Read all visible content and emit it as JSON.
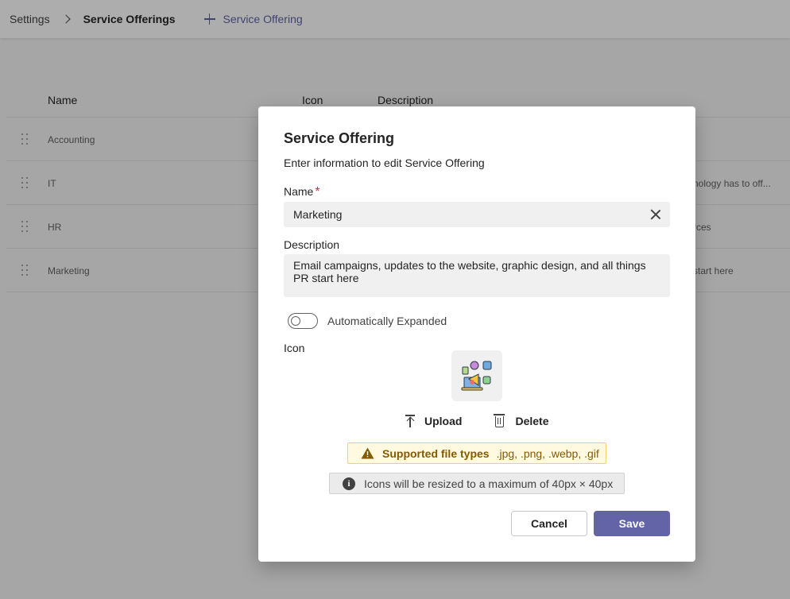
{
  "header": {
    "breadcrumb_root": "Settings",
    "breadcrumb_current": "Service Offerings",
    "add_label": "Service Offering"
  },
  "table": {
    "columns": [
      "Name",
      "Icon",
      "Description"
    ],
    "rows": [
      {
        "name": "Accounting",
        "description": ""
      },
      {
        "name": "IT",
        "description": "nology has to off..."
      },
      {
        "name": "HR",
        "description": "rces"
      },
      {
        "name": "Marketing",
        "description": "start here"
      }
    ]
  },
  "dialog": {
    "title": "Service Offering",
    "subtitle": "Enter information to edit Service Offering",
    "name_label": "Name",
    "required_mark": "*",
    "name_value": "Marketing",
    "description_label": "Description",
    "description_value": "Email campaigns, updates to the website, graphic design, and all things PR start here",
    "toggle_label": "Automatically Expanded",
    "toggle_on": false,
    "icon_label": "Icon",
    "upload_label": "Upload",
    "delete_label": "Delete",
    "warning_title": "Supported file types",
    "warning_types": ".jpg, .png, .webp, .gif",
    "info_text": "Icons will be resized to a maximum of 40px × 40px",
    "cancel_label": "Cancel",
    "save_label": "Save"
  },
  "colors": {
    "accent": "#6264a7",
    "warning_bg": "#fff9e0",
    "warning_text": "#835b00",
    "required": "#c4314b"
  },
  "icons": [
    "chevron-right-icon",
    "plus-icon",
    "drag-handle-icon",
    "close-icon",
    "marketing-icon",
    "upload-icon",
    "trash-icon",
    "warning-icon",
    "info-icon"
  ]
}
